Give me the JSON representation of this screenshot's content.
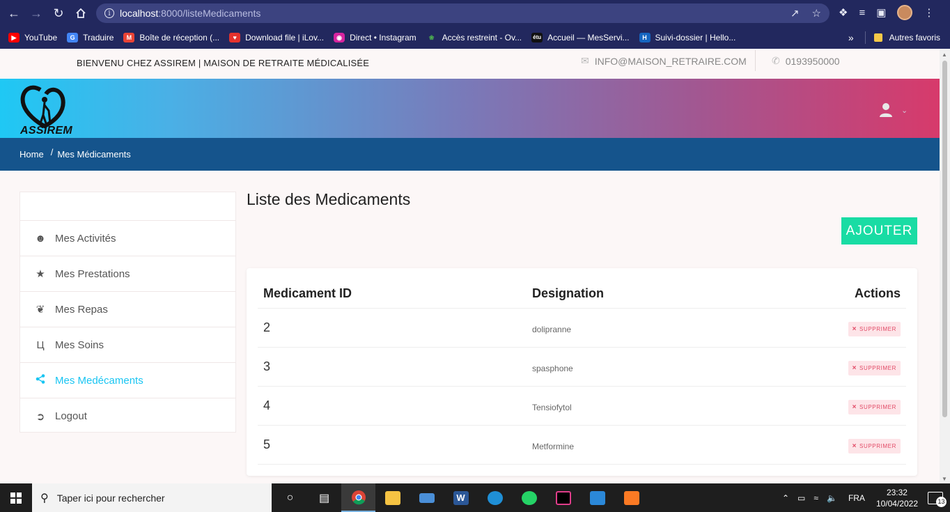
{
  "browser": {
    "url_host": "localhost",
    "url_rest": ":8000/listeMedicaments",
    "bookmarks": [
      {
        "label": "YouTube",
        "color": "#ff0000",
        "icon": "youtube-icon"
      },
      {
        "label": "Traduire",
        "color": "#4285f4",
        "icon": "translate-icon"
      },
      {
        "label": "Boîte de réception (...",
        "color": "#ea4335",
        "icon": "gmail-icon"
      },
      {
        "label": "Download file | iLov...",
        "color": "#e5322d",
        "icon": "ilovepdf-icon"
      },
      {
        "label": "Direct • Instagram",
        "color": "#d6249f",
        "icon": "instagram-icon"
      },
      {
        "label": "Accès restreint - Ov...",
        "color": "#2e7d32",
        "icon": "leaf-icon"
      },
      {
        "label": "Accueil — MesServi...",
        "color": "#111111",
        "icon": "etu-icon"
      },
      {
        "label": "Suivi-dossier | Hello...",
        "color": "#1565c0",
        "icon": "hello-icon"
      }
    ],
    "more_label": "»",
    "other_favorites": "Autres favoris"
  },
  "site": {
    "welcome": "BIENVENU CHEZ ASSIREM | MAISON DE RETRAITE MÉDICALISÉE",
    "email": "INFO@MAISON_RETRAIRE.COM",
    "phone": "0193950000",
    "logo_text": "ASSIREM",
    "breadcrumb": {
      "home": "Home",
      "separator": "/",
      "current": "Mes Médicaments"
    }
  },
  "sidebar": {
    "items": [
      {
        "label": "Mes Activités",
        "icon": "smile-icon",
        "active": false
      },
      {
        "label": "Mes Prestations",
        "icon": "star-icon",
        "active": false
      },
      {
        "label": "Mes Repas",
        "icon": "leaf-icon",
        "active": false
      },
      {
        "label": "Mes Soins",
        "icon": "stethoscope-icon",
        "active": false
      },
      {
        "label": "Mes Medécaments",
        "icon": "share-icon",
        "active": true
      },
      {
        "label": "Logout",
        "icon": "logout-icon",
        "active": false
      }
    ],
    "active_color": "#19c5f2"
  },
  "main": {
    "title": "Liste des Medicaments",
    "add_label": "AJOUTER",
    "add_color": "#19dca4",
    "table": {
      "headers": [
        "Medicament ID",
        "Designation",
        "Actions"
      ],
      "rows": [
        {
          "id": "2",
          "designation": "dolipranne",
          "action": "SUPPRIMER"
        },
        {
          "id": "3",
          "designation": "spasphone",
          "action": "SUPPRIMER"
        },
        {
          "id": "4",
          "designation": "Tensiofytol",
          "action": "SUPPRIMER"
        },
        {
          "id": "5",
          "designation": "Metformine",
          "action": "SUPPRIMER"
        }
      ]
    }
  },
  "taskbar": {
    "search_placeholder": "Taper ici pour rechercher",
    "language": "FRA",
    "time": "23:32",
    "date": "10/04/2022",
    "notifications": "13"
  }
}
